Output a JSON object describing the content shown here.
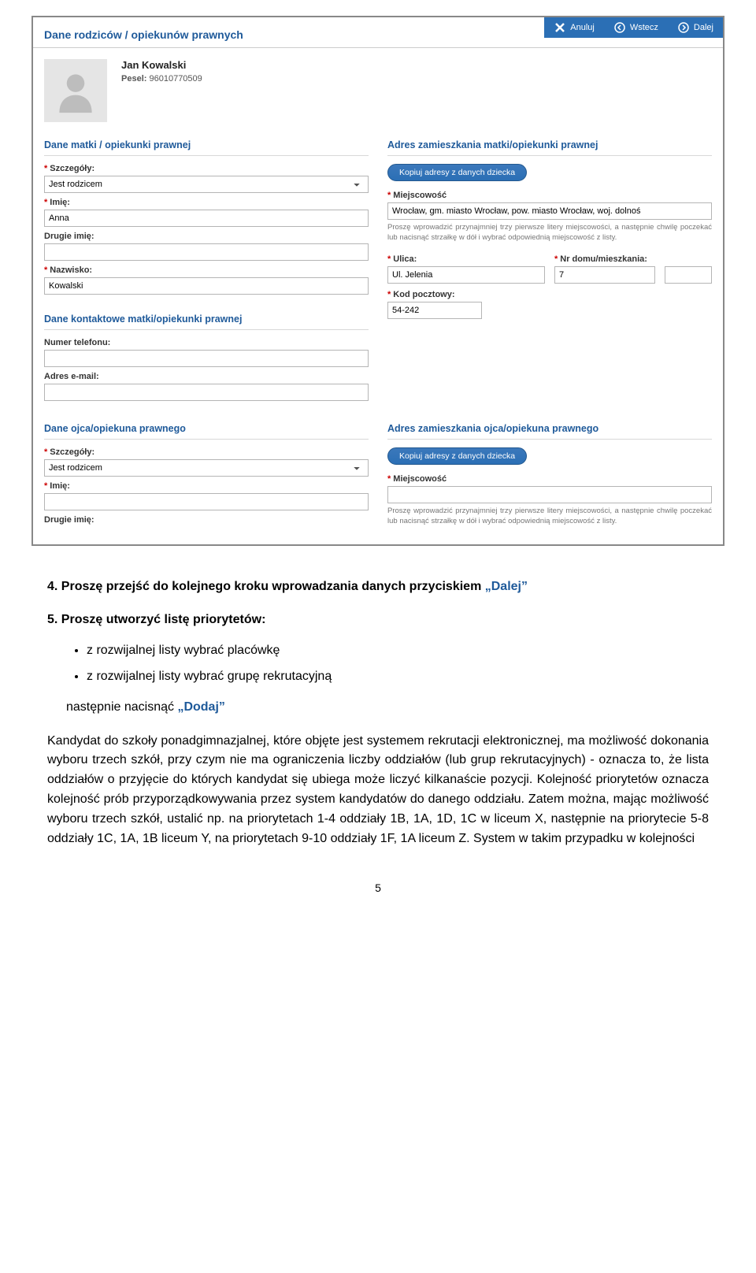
{
  "topActions": {
    "cancel": "Anuluj",
    "back": "Wstecz",
    "next": "Dalej"
  },
  "sectionHeader": "Dane rodziców / opiekunów prawnych",
  "profile": {
    "name": "Jan Kowalski",
    "peselLabel": "Pesel:",
    "pesel": "96010770509"
  },
  "mother": {
    "dataHeader": "Dane matki / opiekunki prawnej",
    "detailsLabel": "Szczegóły:",
    "detailsValue": "Jest rodzicem",
    "firstNameLabel": "Imię:",
    "firstNameValue": "Anna",
    "middleNameLabel": "Drugie imię:",
    "middleNameValue": "",
    "lastNameLabel": "Nazwisko:",
    "lastNameValue": "Kowalski",
    "contactHeader": "Dane kontaktowe matki/opiekunki prawnej",
    "phoneLabel": "Numer telefonu:",
    "phoneValue": "",
    "emailLabel": "Adres e-mail:",
    "emailValue": "",
    "addressHeader": "Adres zamieszkania matki/opiekunki prawnej",
    "copyBtn": "Kopiuj adresy z danych dziecka",
    "cityLabel": "Miejscowość",
    "cityValue": "Wrocław, gm. miasto Wrocław, pow. miasto Wrocław, woj. dolnoś",
    "cityHint": "Proszę wprowadzić przynajmniej trzy pierwsze litery miejscowości, a następnie chwilę poczekać lub nacisnąć strzałkę w dół i wybrać odpowiednią miejscowość z listy.",
    "streetLabel": "Ulica:",
    "streetValue": "Ul. Jelenia",
    "houseLabel": "Nr domu/mieszkania:",
    "houseValue": "7",
    "aptValue": "",
    "postalLabel": "Kod pocztowy:",
    "postalValue": "54-242"
  },
  "father": {
    "dataHeader": "Dane ojca/opiekuna prawnego",
    "detailsLabel": "Szczegóły:",
    "detailsValue": "Jest rodzicem",
    "firstNameLabel": "Imię:",
    "firstNameValue": "",
    "middleNameLabel": "Drugie imię:",
    "addressHeader": "Adres zamieszkania ojca/opiekuna prawnego",
    "copyBtn": "Kopiuj adresy z danych dziecka",
    "cityLabel": "Miejscowość",
    "cityValue": "",
    "cityHint": "Proszę wprowadzić przynajmniej trzy pierwsze litery miejscowości, a następnie chwilę poczekać lub nacisnąć strzałkę w dół i wybrać odpowiednią miejscowość z listy."
  },
  "doc": {
    "step4_lead": "4. Proszę przejść do kolejnego kroku wprowadzania danych przyciskiem ",
    "step4_kw": "„Dalej”",
    "step5_lead": "5. Proszę utworzyć listę priorytetów:",
    "bullet1": "z rozwijalnej listy wybrać placówkę",
    "bullet2": "z rozwijalnej listy wybrać grupę rekrutacyjną",
    "afterList_lead": "następnie nacisnąć ",
    "afterList_kw": "„Dodaj”",
    "para": "Kandydat do szkoły ponadgimnazjalnej, które objęte jest systemem rekrutacji elektronicznej, ma możliwość dokonania wyboru trzech szkół, przy czym nie ma ograniczenia liczby oddziałów (lub grup rekrutacyjnych) - oznacza to, że lista oddziałów o przyjęcie do których kandydat się ubiega może liczyć kilkanaście pozycji. Kolejność priorytetów oznacza kolejność prób przyporządkowywania przez system kandydatów do danego oddziału. Zatem można, mając możliwość wyboru trzech szkół, ustalić np. na priorytetach 1-4 oddziały 1B, 1A, 1D, 1C w liceum X, następnie na priorytecie 5-8 oddziały 1C, 1A, 1B liceum Y, na priorytetach 9-10 oddziały 1F, 1A liceum Z. System w takim przypadku w kolejności",
    "pageNum": "5"
  }
}
